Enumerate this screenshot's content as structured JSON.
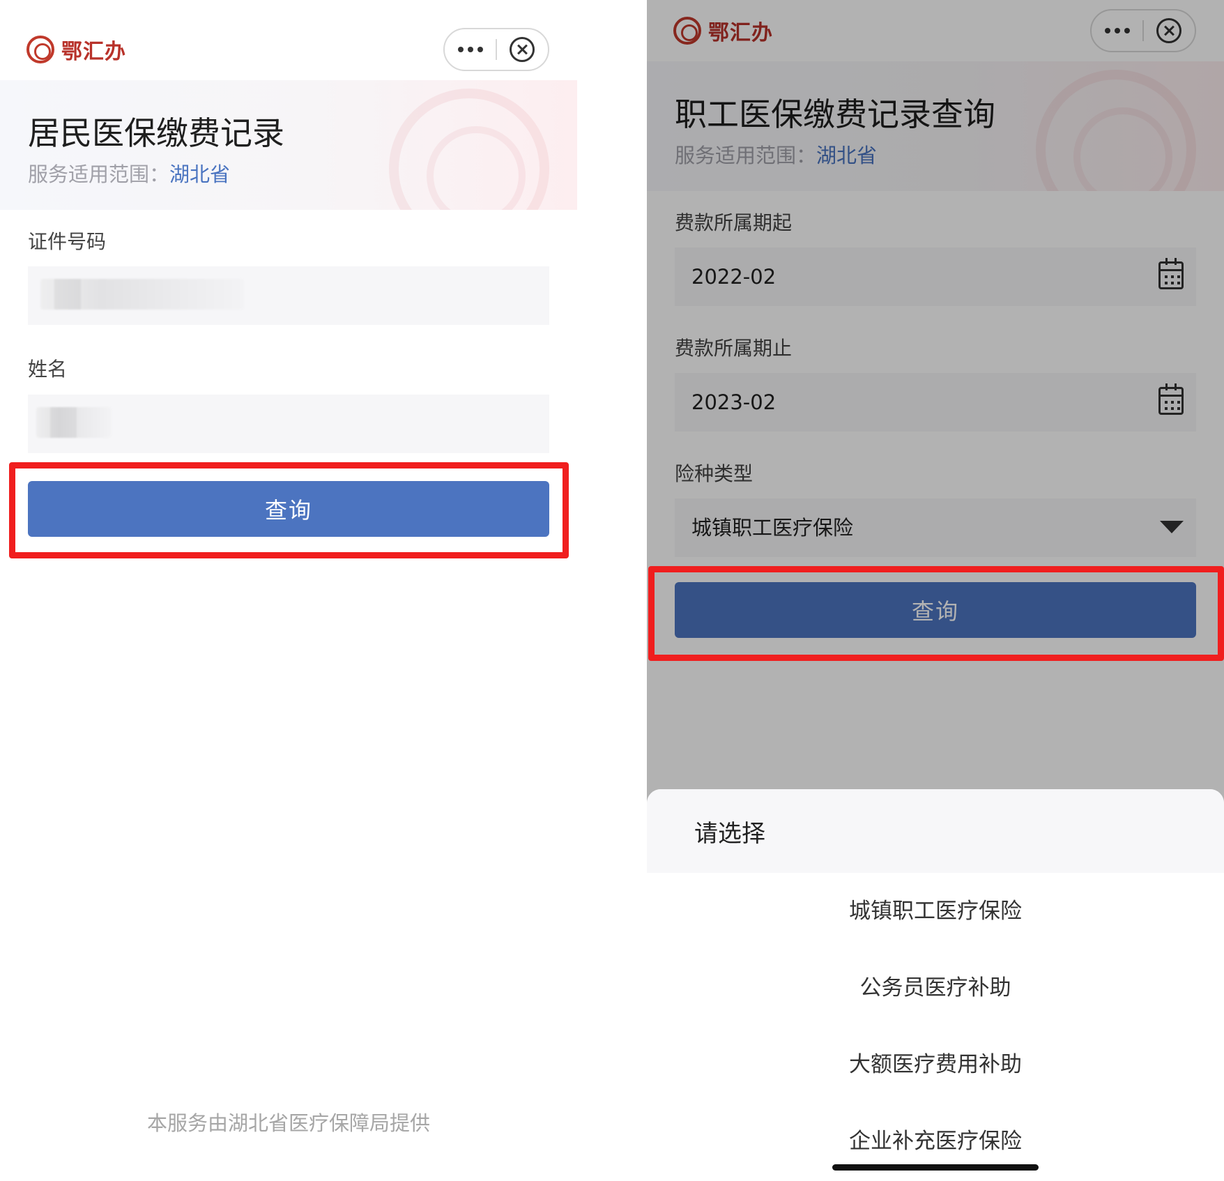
{
  "left": {
    "app_name": "鄂汇办",
    "title": "居民医保缴费记录",
    "scope_label": "服务适用范围：",
    "scope_value": "湖北省",
    "id_label": "证件号码",
    "name_label": "姓名",
    "query_button": "查询",
    "footer": "本服务由湖北省医疗保障局提供"
  },
  "right": {
    "app_name": "鄂汇办",
    "title": "职工医保缴费记录查询",
    "scope_label": "服务适用范围：",
    "scope_value": "湖北省",
    "start_label": "费款所属期起",
    "start_value": "2022-02",
    "end_label": "费款所属期止",
    "end_value": "2023-02",
    "type_label": "险种类型",
    "type_value": "城镇职工医疗保险",
    "query_button": "查询",
    "picker": {
      "title": "请选择",
      "options": [
        "城镇职工医疗保险",
        "公务员医疗补助",
        "大额医疗费用补助",
        "企业补充医疗保险"
      ]
    }
  },
  "colors": {
    "primary": "#4c74c0",
    "highlight_frame": "#f01e1e",
    "brand": "#b8322a"
  },
  "icons": [
    "more-dots-icon",
    "close-circle-icon",
    "calendar-icon",
    "dropdown-triangle-icon",
    "logo-seal-icon"
  ]
}
